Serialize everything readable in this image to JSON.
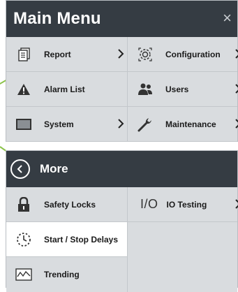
{
  "main_menu": {
    "title": "Main Menu",
    "close_glyph": "×",
    "items": [
      {
        "label": "Report",
        "icon": "report-icon",
        "has_submenu": true
      },
      {
        "label": "Configuration",
        "icon": "configuration-icon",
        "has_submenu": true
      },
      {
        "label": "Alarm List",
        "icon": "alarm-icon",
        "has_submenu": false
      },
      {
        "label": "Users",
        "icon": "users-icon",
        "has_submenu": true
      },
      {
        "label": "System",
        "icon": "system-icon",
        "has_submenu": true
      },
      {
        "label": "Maintenance",
        "icon": "maintenance-icon",
        "has_submenu": true
      }
    ]
  },
  "more_menu": {
    "title": "More",
    "items": [
      {
        "label": "Safety Locks",
        "icon": "lock-icon"
      },
      {
        "label": "IO Testing",
        "icon": "io-icon",
        "icon_text": "I/O",
        "has_submenu": true
      },
      {
        "label": "Start / Stop Delays",
        "icon": "timer-icon"
      },
      {
        "label": "Trending",
        "icon": "trending-icon"
      }
    ]
  },
  "colors": {
    "header": "#353c43",
    "panel": "#d9dcdf",
    "callout": "#8bc34a"
  }
}
